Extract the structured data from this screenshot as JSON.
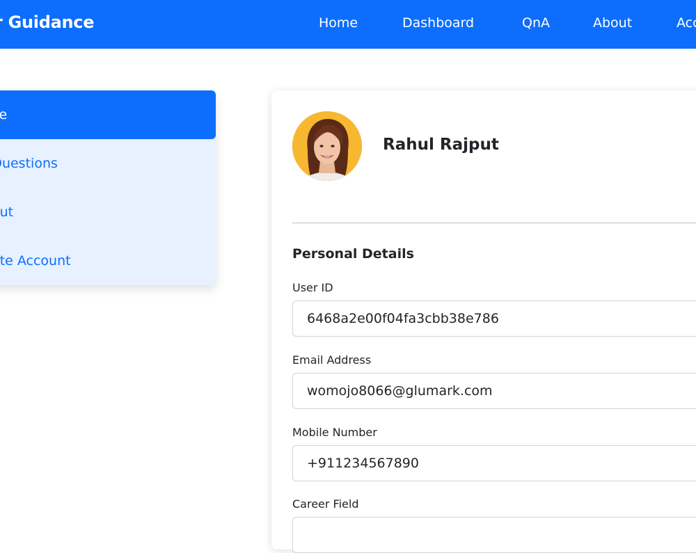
{
  "navbar": {
    "brand": "r Guidance",
    "links": [
      "Home",
      "Dashboard",
      "QnA",
      "About",
      "Acc"
    ]
  },
  "sidebar": {
    "items": [
      {
        "label": "ile",
        "active": true
      },
      {
        "label": "Questions",
        "active": false
      },
      {
        "label": "out",
        "active": false
      },
      {
        "label": "ete Account",
        "active": false
      }
    ]
  },
  "profile": {
    "name": "Rahul Rajput"
  },
  "personal_details": {
    "title": "Personal Details",
    "fields": [
      {
        "label": "User ID",
        "value": "6468a2e00f04fa3cbb38e786"
      },
      {
        "label": "Email Address",
        "value": "womojo8066@glumark.com"
      },
      {
        "label": "Mobile Number",
        "value": "+911234567890"
      },
      {
        "label": "Career Field",
        "value": ""
      }
    ]
  },
  "colors": {
    "primary": "#0d6efd",
    "sidebar_bg": "#e7f1ff",
    "avatar_bg": "#f7b731"
  }
}
